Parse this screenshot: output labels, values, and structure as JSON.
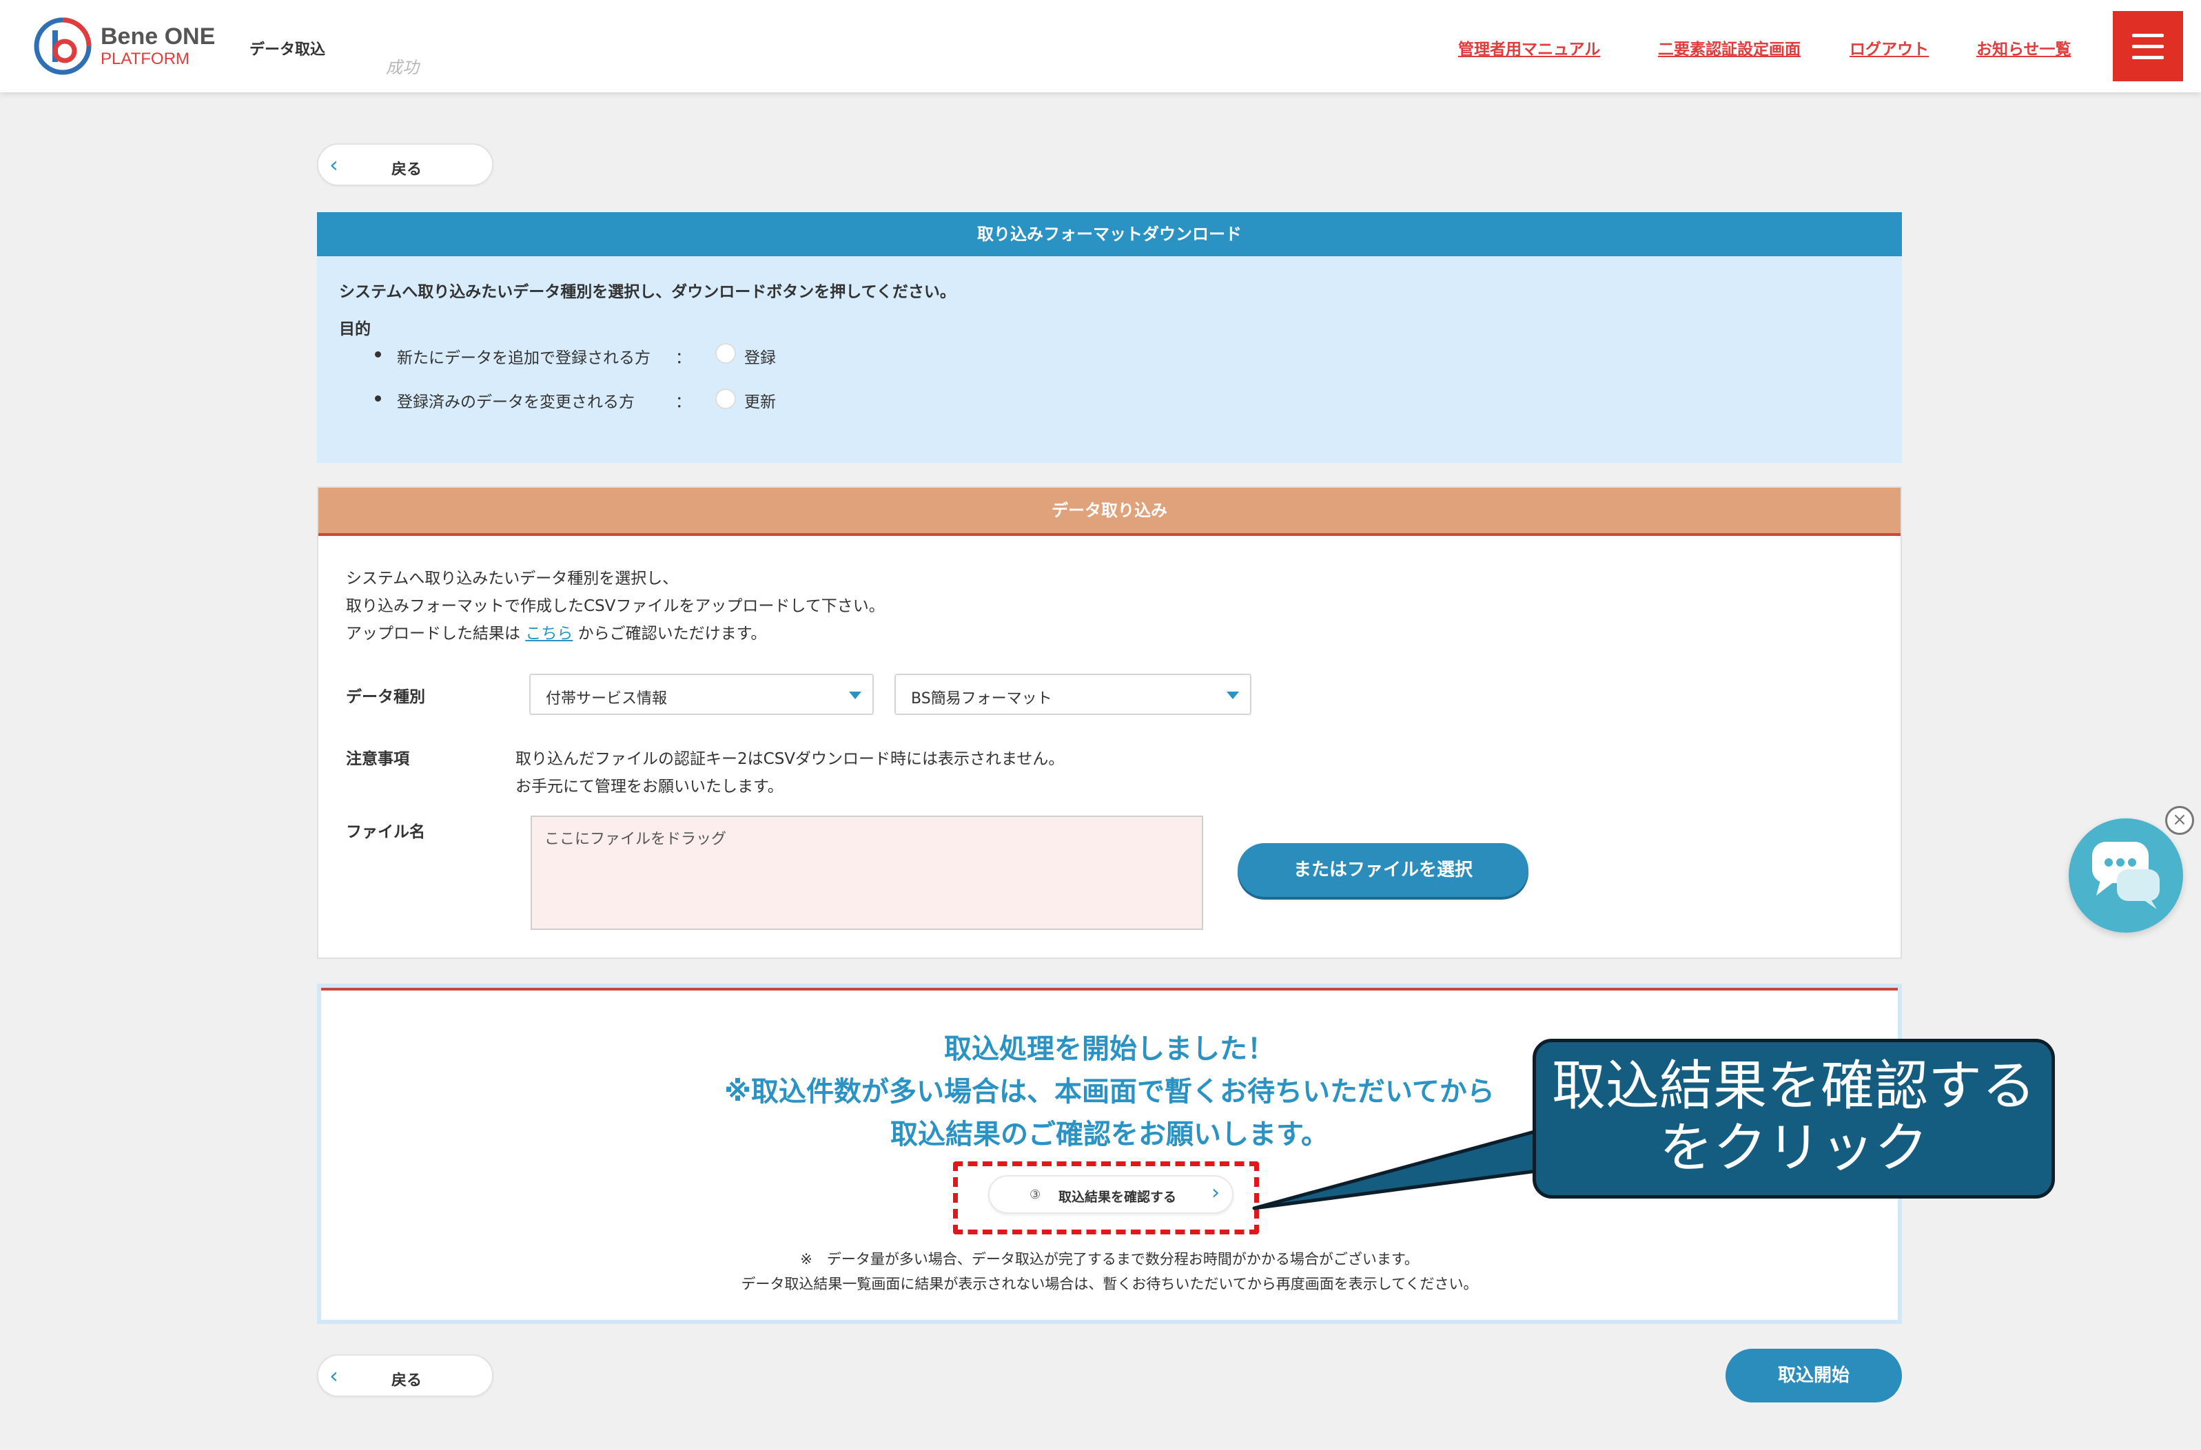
{
  "header": {
    "brand_name": "Bene ONE",
    "brand_sub": "PLATFORM",
    "page_name": "データ取込",
    "stamp": "成功",
    "nav": [
      {
        "label": "管理者用マニュアル"
      },
      {
        "label": "二要素認証設定画面"
      },
      {
        "label": "ログアウト"
      },
      {
        "label": "お知らせ一覧"
      }
    ]
  },
  "back_label": "戻る",
  "format_section": {
    "title": "取り込みフォーマットダウンロード",
    "instruction": "システムへ取り込みたいデータ種別を選択し、ダウンロードボタンを押してください。",
    "purpose_label": "目的",
    "options": [
      {
        "text": "新たにデータを追加で登録される方",
        "sep": "：",
        "radio_label": "登録"
      },
      {
        "text": "登録済みのデータを変更される方",
        "sep": "：",
        "radio_label": "更新"
      }
    ]
  },
  "import_section": {
    "title": "データ取り込み",
    "line1": "システムへ取り込みたいデータ種別を選択し、",
    "line2": "取り込みフォーマットで作成したCSVファイルをアップロードして下さい。",
    "line3_pre": "アップロードした結果は",
    "line3_link": "こちら",
    "line3_post": "からご確認いただけます。",
    "data_type_label": "データ種別",
    "select1": "付帯サービス情報",
    "select2": "BS簡易フォーマット",
    "notes_label": "注意事項",
    "notes_line1": "取り込んだファイルの認証キー2はCSVダウンロード時には表示されません。",
    "notes_line2": "お手元にて管理をお願いいたします。",
    "file_label": "ファイル名",
    "dropzone_placeholder": "ここにファイルをドラッグ",
    "file_button": "またはファイルを選択"
  },
  "status_section": {
    "msg1": "取込処理を開始しました！",
    "msg2": "※取込件数が多い場合は、本画面で暫くお待ちいただいてから",
    "msg3": "取込結果のご確認をお願いします。",
    "confirm_num": "③",
    "confirm_label": "取込結果を確認する",
    "note1": "※　データ量が多い場合、データ取込が完了するまで数分程お時間がかかる場合がございます。",
    "note2": "データ取込結果一覧画面に結果が表示されない場合は、暫くお待ちいただいてから再度画面を表示してください。"
  },
  "callout": {
    "line1": "取込結果を確認する",
    "line2": "をクリック"
  },
  "start_button": "取込開始",
  "colors": {
    "accent_blue": "#2b93c4",
    "header_red": "#e02f24",
    "orange_header": "#dfa27b",
    "callout_bg": "#155d80",
    "highlight_red": "#e0181b"
  }
}
